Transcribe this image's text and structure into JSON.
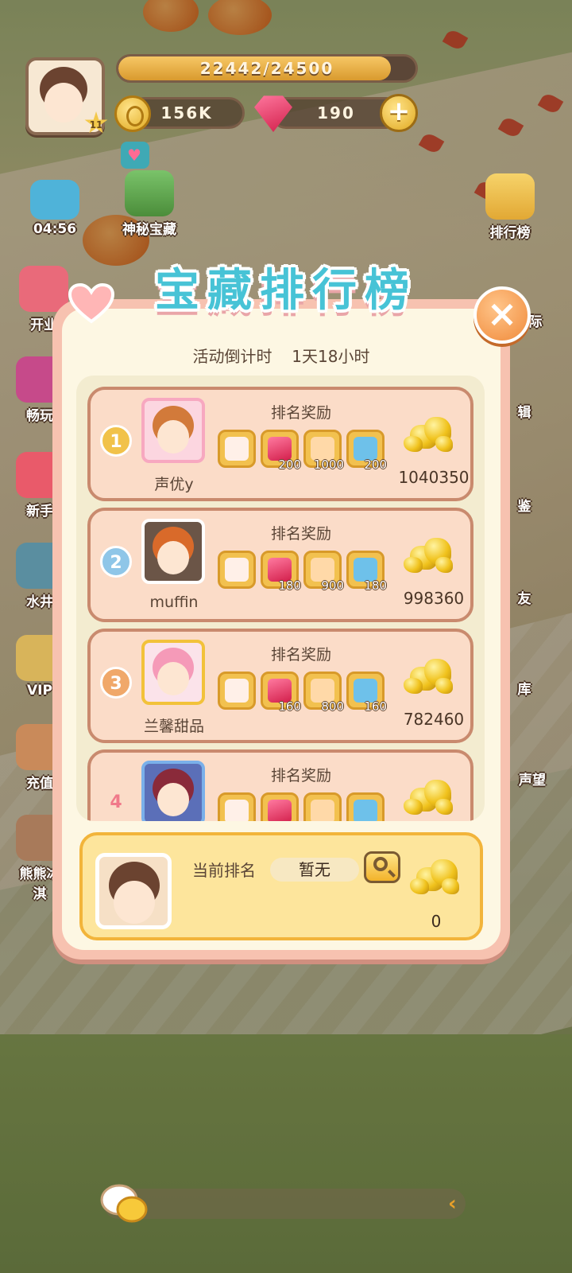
{
  "hud": {
    "level": "11",
    "xp_text": "22442/24500",
    "xp_fraction": 0.916,
    "coins": "156K",
    "gems": "190"
  },
  "left_buttons": [
    {
      "label": "04:56"
    },
    {
      "label": "神秘宝藏"
    },
    {
      "label": "开业"
    },
    {
      "label": "畅玩"
    },
    {
      "label": "新手"
    },
    {
      "label": "水井"
    },
    {
      "label": "VIP"
    },
    {
      "label": "充值"
    },
    {
      "label": "熊熊冰淇"
    }
  ],
  "right_buttons": [
    {
      "label": "排行榜"
    },
    {
      "label": "际"
    },
    {
      "label": "辑"
    },
    {
      "label": "鉴"
    },
    {
      "label": "友"
    },
    {
      "label": "库"
    },
    {
      "label": "声望"
    }
  ],
  "panel": {
    "title": "宝藏排行榜",
    "countdown_label": "活动倒计时",
    "countdown_value": "1天18小时"
  },
  "ranking": [
    {
      "rank": "1",
      "name": "声优y",
      "reward_title": "排名奖励",
      "score": "1040350",
      "rewards": [
        {
          "icon": "card-icon",
          "count": ""
        },
        {
          "icon": "gem-icon",
          "count": "200"
        },
        {
          "icon": "ticket-icon",
          "count": "1000"
        },
        {
          "icon": "potion-icon",
          "count": "200"
        }
      ]
    },
    {
      "rank": "2",
      "name": "muffin",
      "reward_title": "排名奖励",
      "score": "998360",
      "rewards": [
        {
          "icon": "card-icon",
          "count": ""
        },
        {
          "icon": "gem-icon",
          "count": "180"
        },
        {
          "icon": "ticket-icon",
          "count": "900"
        },
        {
          "icon": "potion-icon",
          "count": "180"
        }
      ]
    },
    {
      "rank": "3",
      "name": "兰馨甜品",
      "reward_title": "排名奖励",
      "score": "782460",
      "rewards": [
        {
          "icon": "card-icon",
          "count": ""
        },
        {
          "icon": "gem-icon",
          "count": "160"
        },
        {
          "icon": "ticket-icon",
          "count": "800"
        },
        {
          "icon": "potion-icon",
          "count": "160"
        }
      ]
    },
    {
      "rank": "4",
      "name": "",
      "reward_title": "排名奖励",
      "score": "",
      "rewards": [
        {
          "icon": "card-icon",
          "count": ""
        },
        {
          "icon": "gem-icon",
          "count": ""
        },
        {
          "icon": "ticket-icon",
          "count": ""
        },
        {
          "icon": "potion-icon",
          "count": ""
        }
      ]
    }
  ],
  "me": {
    "label": "当前排名",
    "rank": "暂无",
    "score": "0"
  },
  "colors": {
    "title": "#47c3d6",
    "panel_border": "#f7c2b0",
    "panel_bg": "#fdf7e3",
    "row_bg": "#fbdcc8",
    "rank1": "#f1c24a",
    "rank2": "#8fc6e8",
    "rank3": "#f0a86a",
    "rank4": "#f07a8a"
  }
}
